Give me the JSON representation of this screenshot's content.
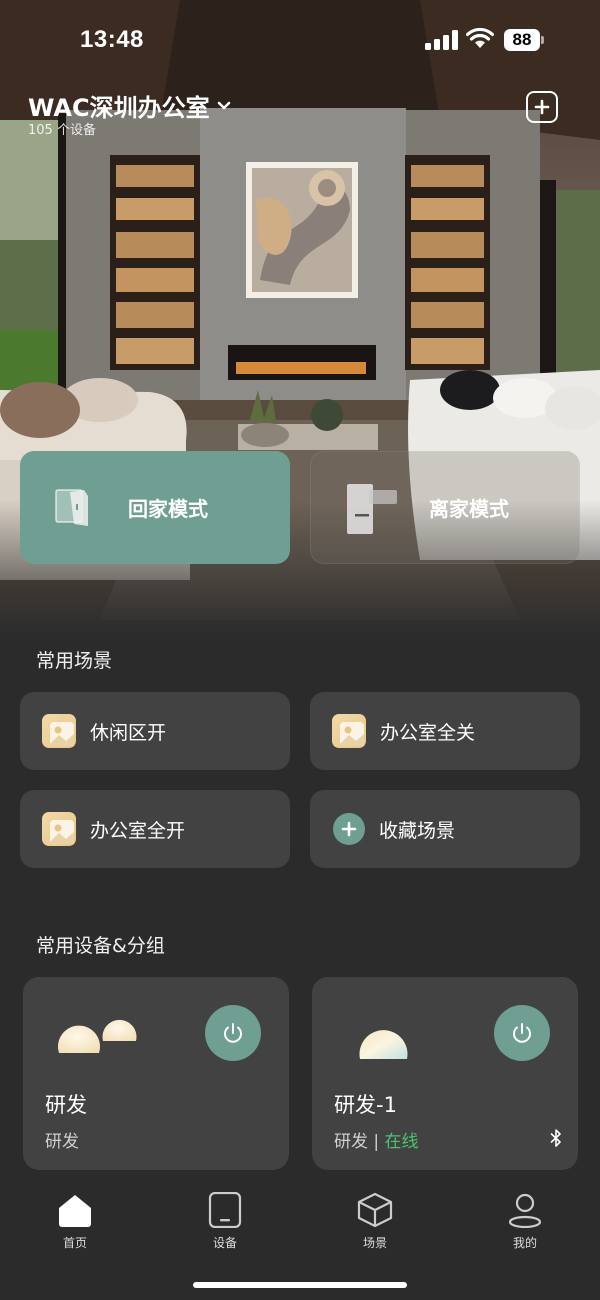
{
  "status_bar": {
    "time": "13:48",
    "battery": "88"
  },
  "header": {
    "home_name": "WAC深圳办公室",
    "device_count": "105 个设备"
  },
  "modes": {
    "home": "回家模式",
    "away": "离家模式"
  },
  "scenes": {
    "title": "常用场景",
    "items": [
      {
        "label": "休闲区开"
      },
      {
        "label": "办公室全关"
      },
      {
        "label": "办公室全开"
      },
      {
        "label": "收藏场景"
      }
    ]
  },
  "devices": {
    "title": "常用设备&分组",
    "items": [
      {
        "name": "研发",
        "sub": "研发"
      },
      {
        "name": "研发-1",
        "sub": "研发",
        "separator": "|",
        "status": "在线"
      }
    ]
  },
  "tabs": [
    {
      "label": "首页"
    },
    {
      "label": "设备"
    },
    {
      "label": "场景"
    },
    {
      "label": "我的"
    }
  ],
  "colors": {
    "accent": "#6f9e92",
    "online": "#4cc472",
    "card": "#424242",
    "background": "#2b2b2b"
  }
}
